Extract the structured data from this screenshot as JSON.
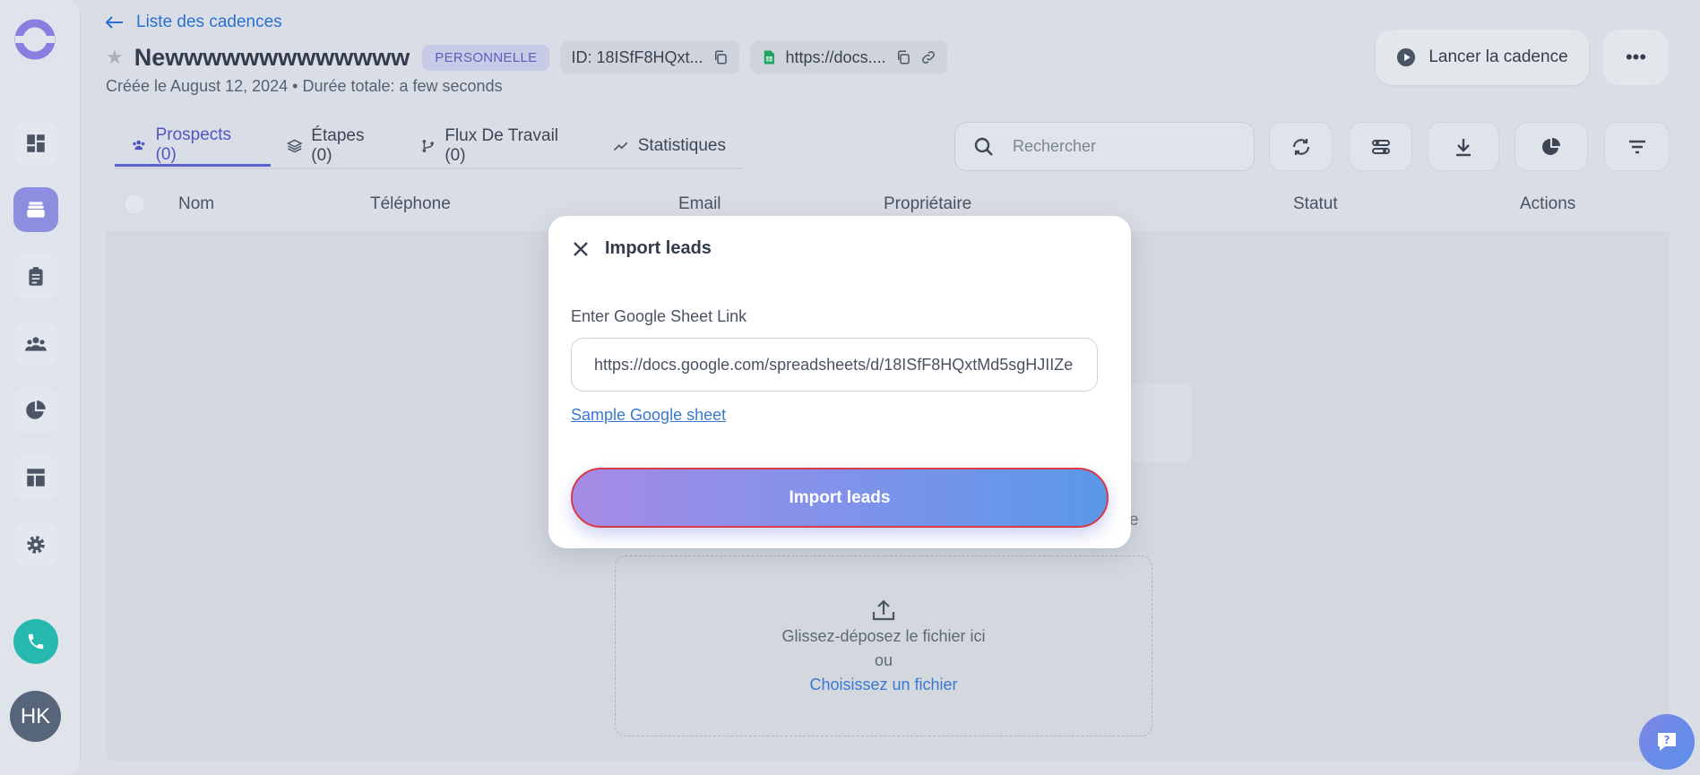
{
  "header": {
    "back_label": "Liste des cadences",
    "title": "Newwwwwwwwwwwww",
    "badge": "PERSONNELLE",
    "id_label": "ID: 18ISfF8HQxt...",
    "sheet_url": "https://docs....",
    "created": "Créée le August 12, 2024 • Durée totale: a few seconds",
    "launch_label": "Lancer la cadence",
    "more_label": "•••"
  },
  "tabs": [
    {
      "label": "Prospects (0)",
      "icon": "users-icon",
      "active": true
    },
    {
      "label": "Étapes (0)",
      "icon": "layers-icon",
      "active": false
    },
    {
      "label": "Flux De Travail (0)",
      "icon": "workflow-icon",
      "active": false
    },
    {
      "label": "Statistiques",
      "icon": "chart-line-icon",
      "active": false
    }
  ],
  "search": {
    "placeholder": "Rechercher"
  },
  "table": {
    "columns": [
      "Nom",
      "Téléphone",
      "Email",
      "Propriétaire",
      "Statut",
      "Actions"
    ]
  },
  "background": {
    "hidden_suffix": "e",
    "dropzone_line1": "Glissez-déposez le fichier ici",
    "dropzone_line2": "ou",
    "dropzone_choose": "Choisissez un fichier"
  },
  "modal": {
    "title": "Import leads",
    "field_label": "Enter Google Sheet Link",
    "field_value": "https://docs.google.com/spreadsheets/d/18ISfF8HQxtMd5sgHJIIZe",
    "sample_link": "Sample Google sheet",
    "submit_label": "Import leads"
  },
  "sidebar": {
    "avatar_initials": "HK"
  },
  "colors": {
    "accent": "#5a5fd0",
    "link": "#3a78cf",
    "danger_border": "#d83a4a",
    "call_button": "#26b9b0"
  }
}
